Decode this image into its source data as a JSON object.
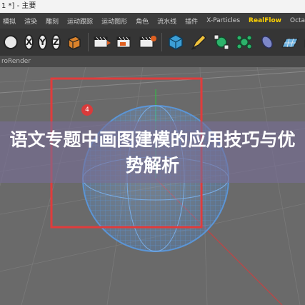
{
  "window": {
    "title": "1 *] - 主要"
  },
  "menu": {
    "items": [
      "模拟",
      "渲染",
      "雕刻",
      "运动跟踪",
      "运动图形",
      "角色",
      "流水线",
      "插件",
      "X-Particles",
      "RealFlow",
      "Octane"
    ],
    "active": "RealFlow"
  },
  "toolbar": {
    "axis_x": "X",
    "axis_y": "Y",
    "axis_z": "Z",
    "icons": [
      "undo-icon",
      "coordinate-system-icon",
      "render-view-icon",
      "render-region-icon",
      "render-settings-icon",
      "cube-icon",
      "pen-icon",
      "subdivision-icon",
      "cloner-icon",
      "deformer-icon",
      "floor-icon",
      "camera-icon"
    ]
  },
  "viewport": {
    "header": "roRender",
    "marker_badge": "4",
    "colors": {
      "selection": "#e03c3c",
      "sphere": "#4f86c6",
      "grid": "#7a7a7a",
      "badge": "#d93b3b"
    }
  },
  "overlay": {
    "headline": "语文专题中画图建模的应用技巧与优势解析"
  }
}
